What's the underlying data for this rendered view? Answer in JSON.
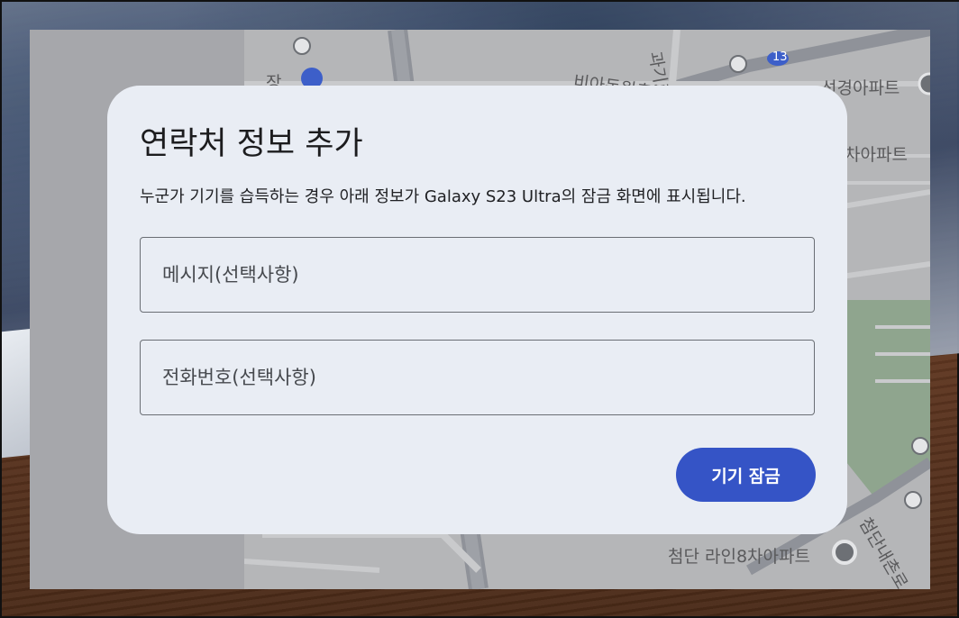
{
  "dialog": {
    "title": "연락처 정보 추가",
    "description": "누군가 기기를 습득하는 경우 아래 정보가 Galaxy S23 Ultra의 잠금 화면에 표시됩니다.",
    "message_field": {
      "value": "",
      "placeholder": "메시지(선택사항)"
    },
    "phone_field": {
      "value": "",
      "placeholder": "전화번호(선택사항)"
    },
    "lock_button_label": "기기 잠금"
  },
  "map": {
    "labels": {
      "road_top": "과기로",
      "route_number": "13",
      "street_top": "비아동원촌길",
      "apt_top_right": "선경아파트",
      "apt_right": "차아파트",
      "apt_bottom": "첨단 라인8차아파트",
      "street_bottom_right": "첨단내촌로",
      "place_left": "장"
    }
  },
  "colors": {
    "accent": "#3554c6",
    "dialog_bg": "#e9edf4"
  }
}
